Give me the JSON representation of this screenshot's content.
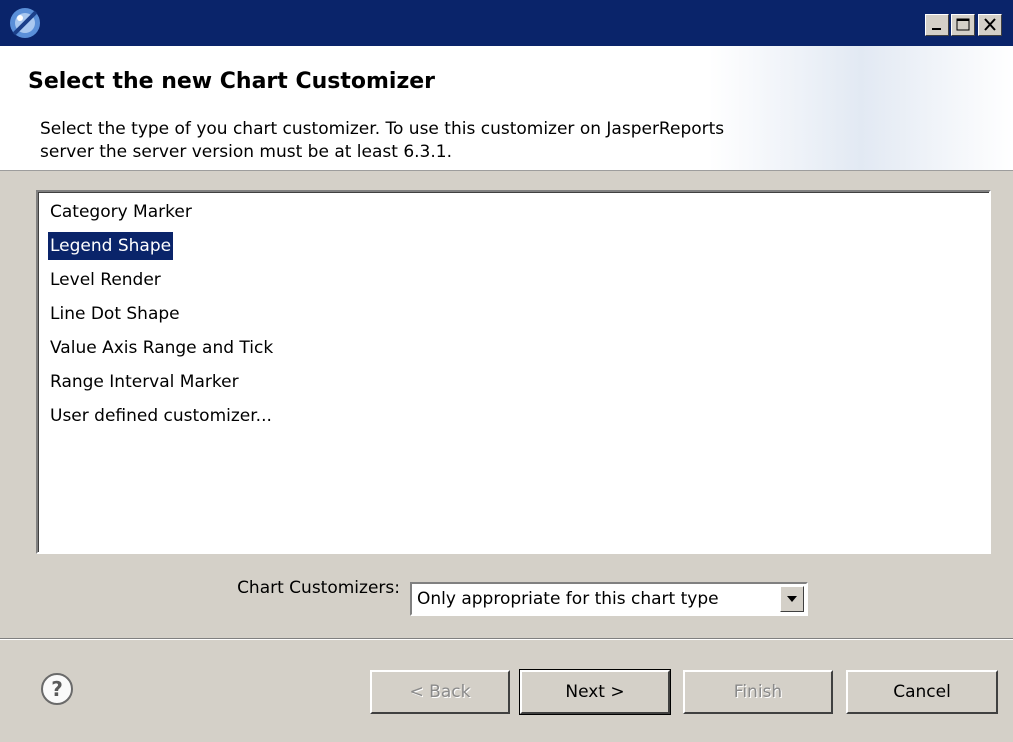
{
  "window": {
    "icon": "jaspersoft-app-icon",
    "minimize_icon": "minimize-icon",
    "maximize_icon": "maximize-icon",
    "close_icon": "close-icon"
  },
  "header": {
    "title": "Select the new Chart Customizer",
    "description": "Select the type of you chart customizer. To use this customizer on JasperReports server the server version must be at least 6.3.1."
  },
  "customizer_list": {
    "items": [
      "Category Marker",
      "Legend Shape",
      "Level Render",
      "Line Dot Shape",
      "Value Axis Range and Tick",
      "Range Interval Marker",
      "User defined customizer..."
    ],
    "selected_index": 1
  },
  "filter": {
    "label": "Chart Customizers:",
    "selected": "Only appropriate for this chart type"
  },
  "footer": {
    "help_icon": "help-icon",
    "back_label": "< Back",
    "next_label": "Next >",
    "finish_label": "Finish",
    "cancel_label": "Cancel"
  },
  "colors": {
    "selection": "#0a246a",
    "dialog_bg": "#d4d0c8"
  }
}
